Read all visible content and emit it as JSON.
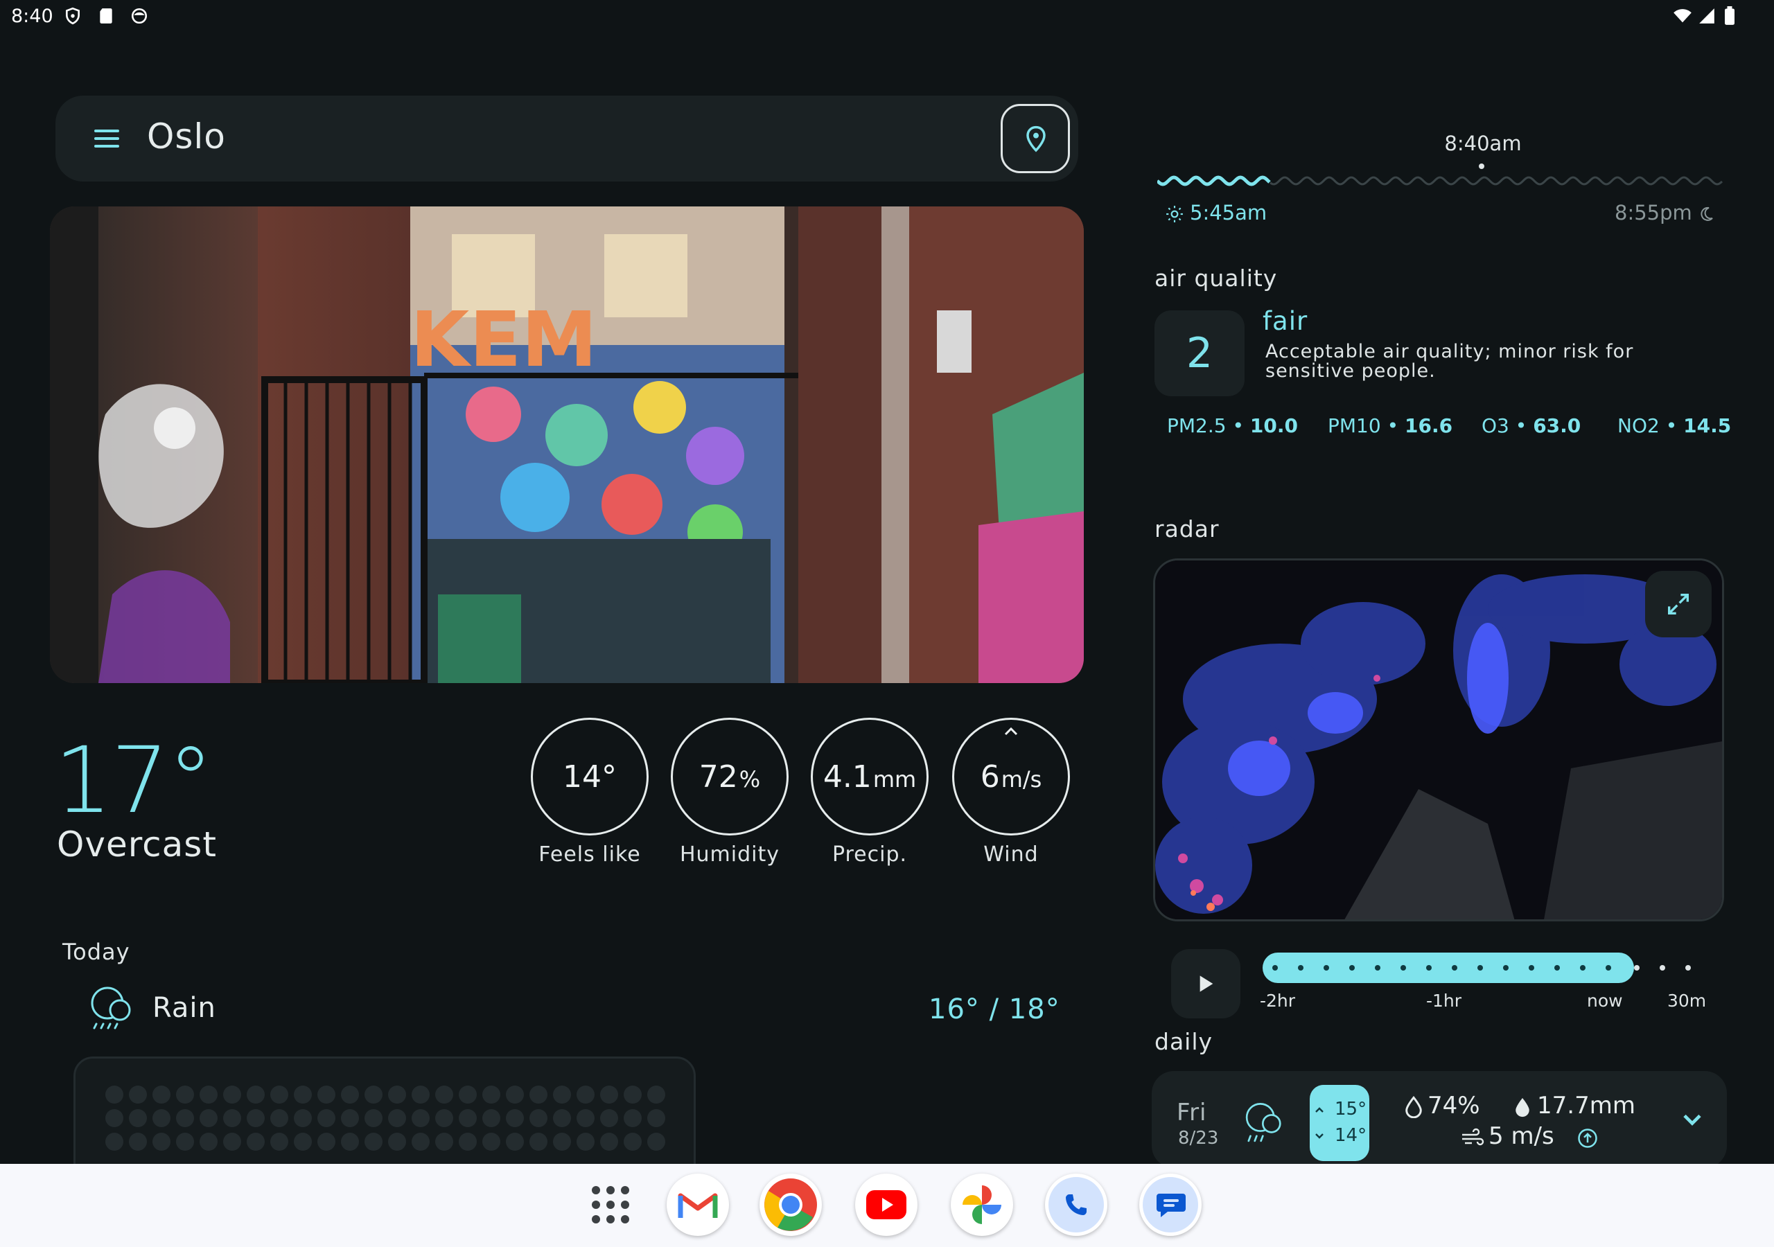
{
  "status_bar": {
    "time": "8:40",
    "icons": [
      "shield-icon",
      "sd-card-icon",
      "face-icon",
      "wifi-icon",
      "signal-icon",
      "battery-icon"
    ]
  },
  "search": {
    "city": "Oslo",
    "menu_icon": "menu-icon",
    "location_icon": "location-pin-icon"
  },
  "current": {
    "temperature": "17°",
    "condition": "Overcast",
    "stats": [
      {
        "value": "14°",
        "unit": "",
        "label": "Feels like"
      },
      {
        "value": "72",
        "unit": "%",
        "label": "Humidity"
      },
      {
        "value": "4.1",
        "unit": "mm",
        "label": "Precip."
      },
      {
        "value": "6",
        "unit": "m/s",
        "label": "Wind"
      }
    ]
  },
  "today": {
    "title": "Today",
    "condition": "Rain",
    "range": "16° / 18°"
  },
  "sun": {
    "now": "8:40am",
    "sunrise": "5:45am",
    "sunset": "8:55pm",
    "day_progress": 0.2
  },
  "air_quality": {
    "title": "air quality",
    "index": "2",
    "level": "fair",
    "description": "Acceptable air quality; minor risk for sensitive people.",
    "pollutants": [
      {
        "name": "PM2.5",
        "value": "10.0"
      },
      {
        "name": "PM10",
        "value": "16.6"
      },
      {
        "name": "O3",
        "value": "63.0"
      },
      {
        "name": "NO2",
        "value": "14.5"
      }
    ]
  },
  "radar": {
    "title": "radar",
    "timeline_labels": [
      "-2hr",
      "-1hr",
      "now",
      "30m"
    ],
    "progress": 0.83
  },
  "daily": {
    "title": "daily",
    "days": [
      {
        "day": "Fri",
        "date": "8/23",
        "high": "15°",
        "low": "14°",
        "precip_prob": "74%",
        "precip_amt": "17.7mm",
        "wind": "5 m/s"
      }
    ]
  },
  "colors": {
    "accent": "#7fe3ec",
    "background": "#0f1416",
    "surface": "#1a2123"
  },
  "taskbar": {
    "apps": [
      "app-drawer-icon",
      "gmail-icon",
      "chrome-icon",
      "youtube-icon",
      "photos-icon",
      "phone-icon",
      "messages-icon"
    ]
  }
}
